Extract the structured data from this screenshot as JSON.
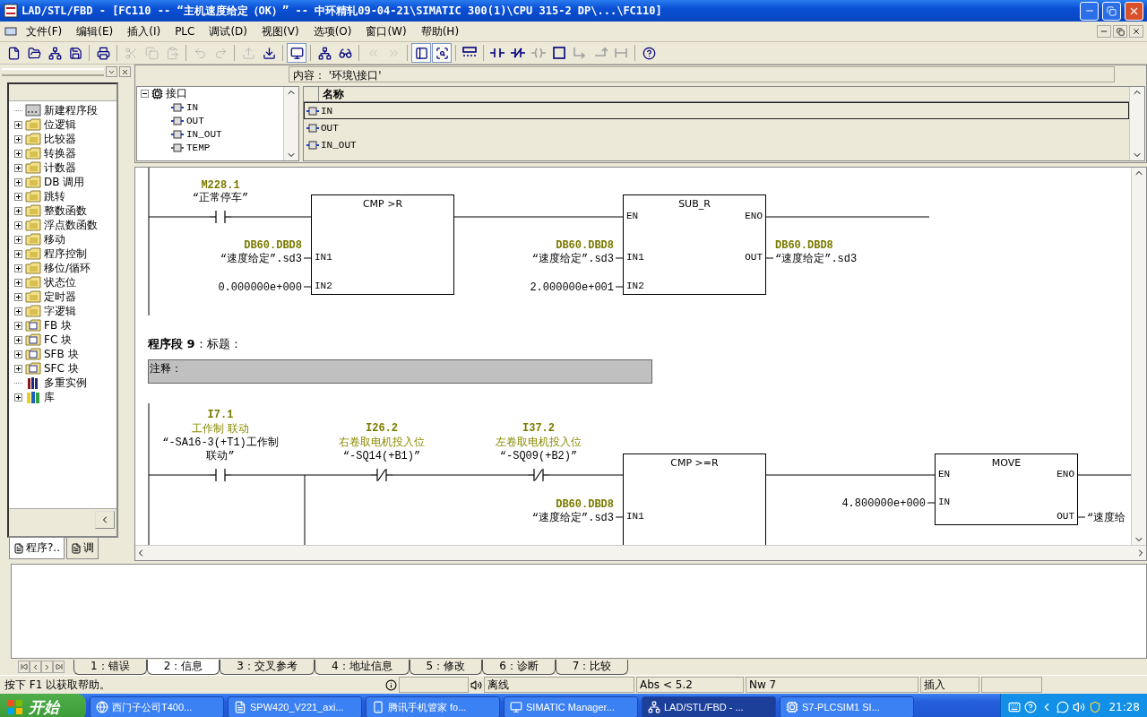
{
  "window": {
    "title": "LAD/STL/FBD  - [FC110 -- “主机速度给定（OK）” -- 中环精轧09-04-21\\SIMATIC 300(1)\\CPU 315-2 DP\\...\\FC110]"
  },
  "menu": [
    "文件(F)",
    "编辑(E)",
    "插入(I)",
    "PLC",
    "调试(D)",
    "视图(V)",
    "选项(O)",
    "窗口(W)",
    "帮助(H)"
  ],
  "toolbar": [
    {
      "disabled": false,
      "pressed": false
    },
    {
      "disabled": false,
      "pressed": false
    },
    {
      "disabled": false,
      "pressed": false
    },
    {
      "disabled": false,
      "pressed": false
    },
    {
      "disabled": false,
      "pressed": false
    },
    {
      "disabled": true,
      "pressed": false
    },
    {
      "disabled": true,
      "pressed": false
    },
    {
      "disabled": true,
      "pressed": false
    },
    {
      "disabled": true,
      "pressed": false
    },
    {
      "disabled": true,
      "pressed": false
    },
    {
      "disabled": true,
      "pressed": false
    },
    {
      "disabled": false,
      "pressed": false
    },
    {
      "disabled": false,
      "pressed": true
    },
    {
      "disabled": false,
      "pressed": false
    },
    {
      "disabled": false,
      "pressed": false
    },
    {
      "disabled": true,
      "pressed": false
    },
    {
      "disabled": true,
      "pressed": false
    },
    {
      "disabled": false,
      "pressed": true
    },
    {
      "disabled": false,
      "pressed": true
    },
    {
      "disabled": false,
      "pressed": false
    },
    {
      "disabled": false,
      "pressed": false
    },
    {
      "disabled": false,
      "pressed": false
    },
    {
      "disabled": true,
      "pressed": false
    },
    {
      "disabled": false,
      "pressed": false
    },
    {
      "disabled": true,
      "pressed": false
    },
    {
      "disabled": true,
      "pressed": false
    },
    {
      "disabled": true,
      "pressed": false
    },
    {
      "disabled": false,
      "pressed": false
    }
  ],
  "catalog": {
    "items": [
      {
        "kind": "network",
        "label": "新建程序段"
      },
      {
        "kind": "folder",
        "label": "位逻辑"
      },
      {
        "kind": "folder",
        "label": "比较器"
      },
      {
        "kind": "folder",
        "label": "转换器"
      },
      {
        "kind": "folder",
        "label": "计数器"
      },
      {
        "kind": "folder",
        "label": "DB 调用"
      },
      {
        "kind": "folder",
        "label": "跳转"
      },
      {
        "kind": "folder",
        "label": "整数函数"
      },
      {
        "kind": "folder",
        "label": "浮点数函数"
      },
      {
        "kind": "folder",
        "label": "移动"
      },
      {
        "kind": "folder",
        "label": "程序控制"
      },
      {
        "kind": "folder",
        "label": "移位/循环"
      },
      {
        "kind": "folder",
        "label": "状态位"
      },
      {
        "kind": "folder",
        "label": "定时器"
      },
      {
        "kind": "folder",
        "label": "字逻辑"
      },
      {
        "kind": "block",
        "label": "FB 块"
      },
      {
        "kind": "block",
        "label": "FC 块"
      },
      {
        "kind": "block",
        "label": "SFB 块"
      },
      {
        "kind": "block",
        "label": "SFC 块"
      },
      {
        "kind": "instances",
        "label": "多重实例"
      },
      {
        "kind": "library",
        "label": "库"
      }
    ],
    "tabs": [
      {
        "label": "程序?..",
        "selected": true
      },
      {
        "label": "调",
        "selected": false
      }
    ]
  },
  "interface": {
    "path": "内容：  '环境\\接口'",
    "tree": {
      "label": "接口",
      "expanded": true,
      "children": [
        {
          "label": "IN"
        },
        {
          "label": "OUT"
        },
        {
          "label": "IN_OUT"
        },
        {
          "label": "TEMP"
        }
      ]
    },
    "columns": [
      "名称"
    ],
    "rows": [
      {
        "name": "IN",
        "selected": true
      },
      {
        "name": "OUT",
        "selected": false
      },
      {
        "name": "IN_OUT",
        "selected": false
      }
    ]
  },
  "editor": {
    "networks": [
      {
        "elements": [
          {
            "kind": "contact",
            "negated": false,
            "address": "M228.1",
            "symbol": "“正常停车”"
          },
          {
            "kind": "box",
            "title": "CMP >R",
            "left_pins": [
              {
                "pin": "IN1",
                "address": "DB60.DBD8",
                "operand": "“速度给定”.sd3"
              },
              {
                "pin": "IN2",
                "operand": "0.000000e+000"
              }
            ]
          },
          {
            "kind": "box",
            "title": "SUB_R",
            "enable": "EN",
            "enable_out": "ENO",
            "left_pins": [
              {
                "pin": "IN1",
                "address": "DB60.DBD8",
                "operand": "“速度给定”.sd3"
              },
              {
                "pin": "IN2",
                "operand": "2.000000e+001"
              }
            ],
            "right_pins": [
              {
                "pin": "OUT",
                "address": "DB60.DBD8",
                "operand": "“速度给定”.sd3"
              }
            ]
          }
        ]
      },
      {
        "title": "**程序段 9**：标题：",
        "comment": "注释：",
        "elements": [
          {
            "kind": "contact",
            "negated": false,
            "address": "I7.1",
            "comment": "工作制 联动",
            "symbol": "“-SA16-3(+T1)工作制联动”"
          },
          {
            "kind": "contact",
            "negated": true,
            "address": "I26.2",
            "comment": "右卷取电机投入位",
            "symbol": "“-SQ14(+B1)”"
          },
          {
            "kind": "contact",
            "negated": true,
            "address": "I37.2",
            "comment": "左卷取电机投入位",
            "symbol": "“-SQ09(+B2)”"
          },
          {
            "kind": "box",
            "title": "CMP >=R",
            "left_pins": [
              {
                "pin": "IN1",
                "address": "DB60.DBD8",
                "operand": "“速度给定”.sd3"
              }
            ]
          },
          {
            "kind": "box",
            "title": "MOVE",
            "enable": "EN",
            "enable_out": "ENO",
            "left_pins": [
              {
                "pin": "IN",
                "operand": "4.800000e+000"
              }
            ],
            "right_pins": [
              {
                "pin": "OUT",
                "operand": "“速度给"
              }
            ]
          }
        ]
      }
    ]
  },
  "output": {
    "tabs": [
      {
        "label": "1：错误",
        "selected": false
      },
      {
        "label": "2：信息",
        "selected": true
      },
      {
        "label": "3：交叉参考",
        "selected": false
      },
      {
        "label": "4：地址信息",
        "selected": false
      },
      {
        "label": "5：修改",
        "selected": false
      },
      {
        "label": "6：诊断",
        "selected": false
      },
      {
        "label": "7：比较",
        "selected": false
      }
    ]
  },
  "status_bar": {
    "help": "按下 F1 以获取帮助。",
    "mode": "离线",
    "address": "Abs < 5.2",
    "network": "Nw 7",
    "edit_mode": "插入"
  },
  "taskbar": {
    "start": "开始",
    "tasks": [
      {
        "label": "西门子公司T400...",
        "selected": false
      },
      {
        "label": "SPW420_V221_axi...",
        "selected": false
      },
      {
        "label": "腾讯手机管家 fo...",
        "selected": false
      },
      {
        "label": "SIMATIC Manager...",
        "selected": false
      },
      {
        "label": "LAD/STL/FBD  - ...",
        "selected": true
      },
      {
        "label": "S7-PLCSIM1   SI...",
        "selected": false
      }
    ],
    "clock": "21:28"
  }
}
